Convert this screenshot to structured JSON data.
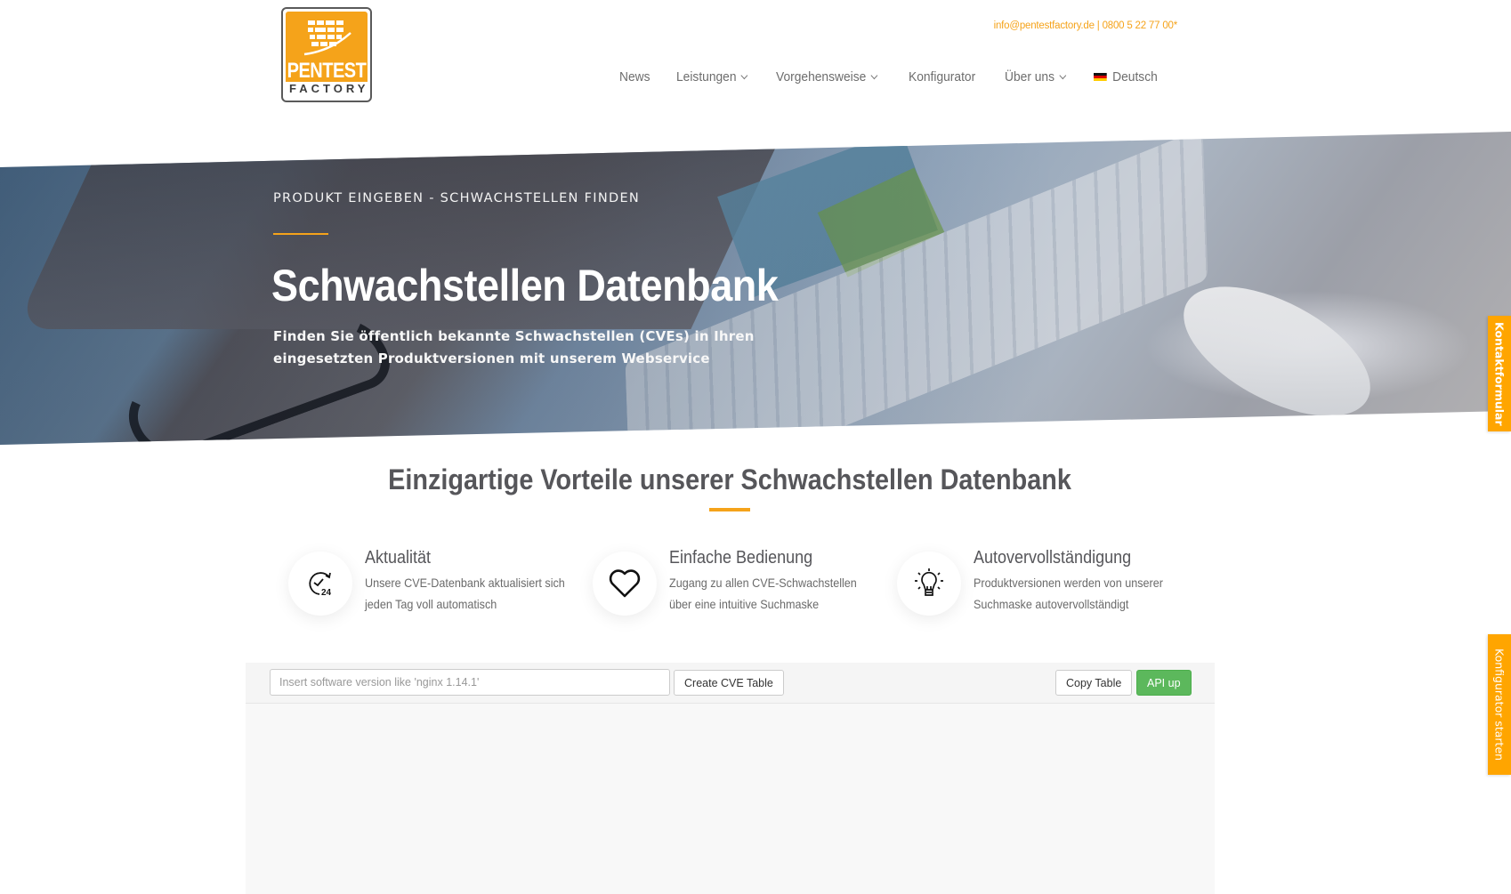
{
  "brand": {
    "logo_line1": "PENTEST",
    "logo_line2": "FACTORY",
    "accent_color": "#f5a31a"
  },
  "header": {
    "email": "info@pentestfactory.de",
    "separator": " | ",
    "phone": "0800 5 22 77 00*"
  },
  "nav": {
    "items": [
      {
        "label": "News",
        "has_dropdown": false
      },
      {
        "label": "Leistungen",
        "has_dropdown": true
      },
      {
        "label": "Vorgehensweise",
        "has_dropdown": true
      },
      {
        "label": "Konfigurator",
        "has_dropdown": false
      },
      {
        "label": "Über uns",
        "has_dropdown": true
      }
    ],
    "language": {
      "label": "Deutsch",
      "icon": "germany-flag-icon"
    }
  },
  "hero": {
    "kicker": "PRODUKT EINGEBEN - SCHWACHSTELLEN FINDEN",
    "title": "Schwachstellen Datenbank",
    "subtitle": "Finden Sie öffentlich bekannte Schwachstellen (CVEs) in Ihren eingesetzten Produktversionen mit unserem Webservice"
  },
  "benefits": {
    "heading": "Einzigartige Vorteile unserer Schwachstellen Datenbank",
    "items": [
      {
        "icon": "clock-24-icon",
        "title": "Aktualität",
        "line1": "Unsere CVE-Datenbank aktualisiert sich",
        "line2": "jeden Tag voll automatisch"
      },
      {
        "icon": "heart-icon",
        "title": "Einfache Bedienung",
        "line1": "Zugang zu allen CVE-Schwachstellen",
        "line2": "über eine intuitive Suchmaske"
      },
      {
        "icon": "lightbulb-icon",
        "title": "Autovervollständigung",
        "line1": "Produktversionen werden von unserer",
        "line2": "Suchmaske autovervollständigt"
      }
    ]
  },
  "tool": {
    "search_placeholder": "Insert software version like 'nginx 1.14.1'",
    "search_value": "",
    "create_button": "Create CVE Table",
    "copy_button": "Copy Table",
    "api_status": "API up",
    "api_status_color": "#5cb85c"
  },
  "side_tabs": {
    "contact": "Kontaktformular",
    "configurator": "Konfigurator starten",
    "color": "#ffa500"
  }
}
